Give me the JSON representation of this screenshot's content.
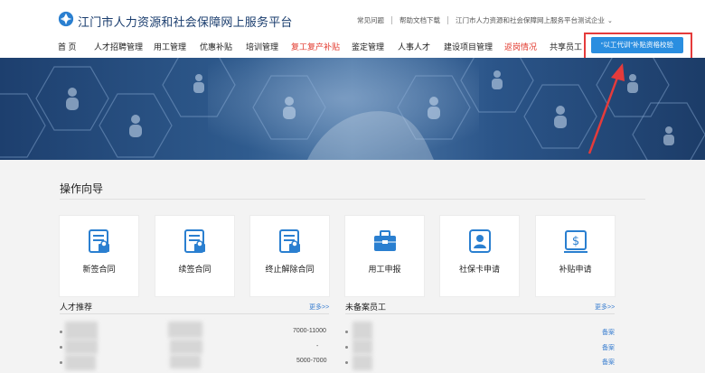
{
  "header": {
    "site_title": "江门市人力资源和社会保障网上服务平台",
    "top_links": [
      "常见问题",
      "帮助文档下载"
    ],
    "org_name": "江门市人力资源和社会保障网上服务平台测试企业",
    "dropdown_glyph": "⌄"
  },
  "nav": {
    "items": [
      {
        "label": "首 页",
        "color": "#222222"
      },
      {
        "label": "人才招聘管理",
        "color": "#222222"
      },
      {
        "label": "用工管理",
        "color": "#222222"
      },
      {
        "label": "优惠补贴",
        "color": "#222222"
      },
      {
        "label": "培训管理",
        "color": "#222222"
      },
      {
        "label": "复工复产补贴",
        "color": "#e23a2e"
      },
      {
        "label": "鉴定管理",
        "color": "#222222"
      },
      {
        "label": "人事人才",
        "color": "#222222"
      },
      {
        "label": "建设项目管理",
        "color": "#222222"
      },
      {
        "label": "返岗情况",
        "color": "#e23a2e"
      },
      {
        "label": "共享员工",
        "color": "#222222"
      }
    ],
    "highlight_button": "“以工代训”补贴资格校验"
  },
  "guide": {
    "title": "操作向导",
    "cards": [
      {
        "label": "新签合同",
        "icon": "contract-icon"
      },
      {
        "label": "续签合同",
        "icon": "contract-renew-icon"
      },
      {
        "label": "终止解除合同",
        "icon": "contract-terminate-icon"
      },
      {
        "label": "用工申报",
        "icon": "briefcase-icon"
      },
      {
        "label": "社保卡申请",
        "icon": "id-card-icon"
      },
      {
        "label": "补贴申请",
        "icon": "money-icon"
      }
    ]
  },
  "lists": {
    "talent": {
      "title": "人才推荐",
      "more": "更多>>",
      "rows": [
        {
          "salary": "7000-11000"
        },
        {
          "salary": "-"
        },
        {
          "salary": "5000-7000"
        }
      ]
    },
    "unfiled": {
      "title": "未备案员工",
      "more": "更多>>",
      "rows": [
        {
          "action": "备案"
        },
        {
          "action": "备案"
        },
        {
          "action": "备案"
        }
      ]
    }
  },
  "colors": {
    "brand_blue": "#1a3d6e",
    "button_blue": "#2a8ee0",
    "annotation_red": "#e53b3b",
    "nav_red": "#e23a2e"
  }
}
